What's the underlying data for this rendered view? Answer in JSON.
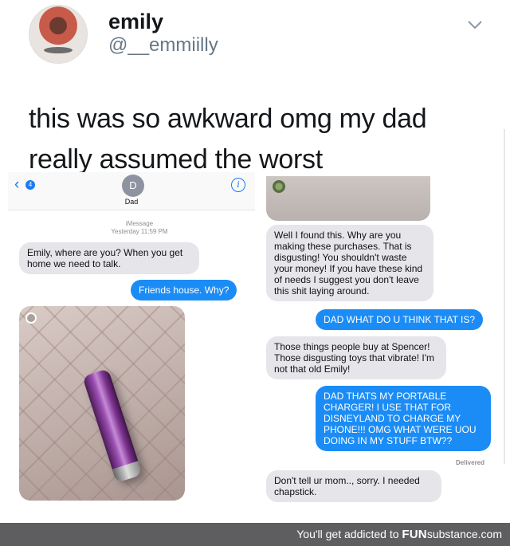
{
  "tweet": {
    "display_name": "emily",
    "handle": "@__emmiilly",
    "text_line1": "this was so awkward omg my dad",
    "text_line2": "really assumed the worst",
    "menu_icon": "chevron-down-icon"
  },
  "imessage_left": {
    "back_count": "4",
    "contact_initial": "D",
    "contact_name": "Dad",
    "service_label": "iMessage",
    "timestamp": "Yesterday 11:59 PM",
    "messages": [
      {
        "from": "dad",
        "text": "Emily, where are you? When you get home we need to talk."
      },
      {
        "from": "me",
        "text": "Friends house. Why?"
      }
    ],
    "accent_color": "#1b8cf6"
  },
  "imessage_right": {
    "messages": [
      {
        "from": "dad",
        "text": "Well I found this. Why are you making these purchases. That is disgusting! You shouldn't waste your money! If you have these kind of needs I suggest you don't leave this shit laying around."
      },
      {
        "from": "me",
        "text": "DAD WHAT DO U THINK THAT IS?"
      },
      {
        "from": "dad",
        "text": "Those things people buy at Spencer! Those disgusting toys that vibrate! I'm not that old Emily!"
      },
      {
        "from": "me",
        "text": "DAD THATS MY PORTABLE CHARGER! I USE THAT FOR DISNEYLAND TO CHARGE MY PHONE!!! OMG WHAT WERE UOU DOING IN MY STUFF BTW??"
      },
      {
        "from": "dad",
        "text": "Don't tell ur mom.., sorry. I needed chapstick."
      }
    ],
    "delivered_label": "Delivered"
  },
  "footer": {
    "tagline": "You'll get addicted to ",
    "brand_prefix": "FUN",
    "brand_suffix": "substance.com"
  }
}
